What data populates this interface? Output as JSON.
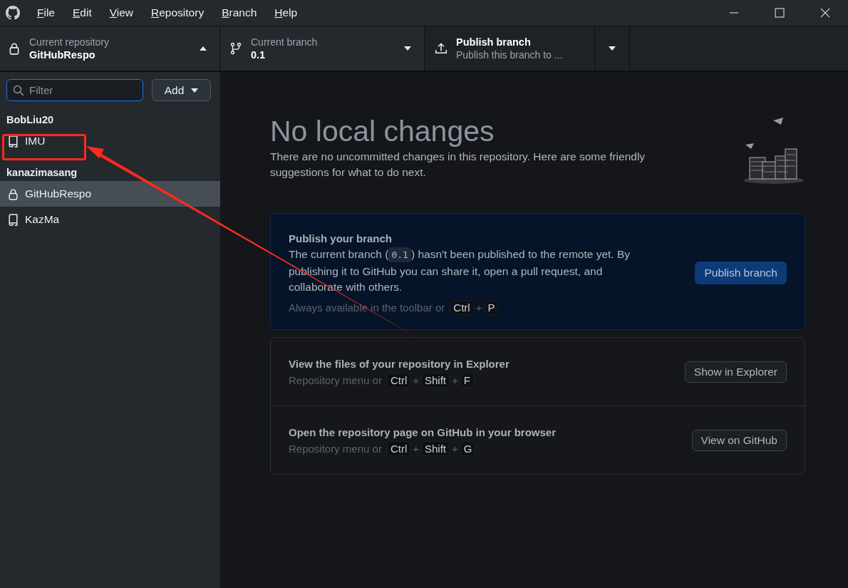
{
  "menu": [
    "File",
    "Edit",
    "View",
    "Repository",
    "Branch",
    "Help"
  ],
  "toolbar": {
    "repository": {
      "label": "Current repository",
      "value": "GitHubRespo",
      "expanded": true
    },
    "branch": {
      "label": "Current branch",
      "value": "0.1"
    },
    "publish": {
      "label": "Publish branch",
      "description": "Publish this branch to ..."
    }
  },
  "sidebar": {
    "filter": {
      "placeholder": "Filter"
    },
    "add_button": "Add",
    "groups": [
      {
        "owner": "BobLiu20",
        "repos": [
          {
            "name": "IMU",
            "kind": "public",
            "selected": false
          }
        ]
      },
      {
        "owner": "kanazimasang",
        "repos": [
          {
            "name": "GitHubRespo",
            "kind": "private",
            "selected": true
          },
          {
            "name": "KazMa",
            "kind": "public",
            "selected": false
          }
        ]
      }
    ]
  },
  "main": {
    "title": "No local changes",
    "subtitle": "There are no uncommitted changes in this repository. Here are some friendly suggestions for what to do next.",
    "publish_card": {
      "title": "Publish your branch",
      "text_before": "The current branch (",
      "code": "0.1",
      "text_after": ") hasn't been published to the remote yet. By publishing it to GitHub you can share it, open a pull request, and collaborate with others.",
      "hint": "Always available in the toolbar or",
      "shortcut": [
        {
          "kind": "key",
          "text": "Ctrl"
        },
        {
          "kind": "sep",
          "text": "+"
        },
        {
          "kind": "key",
          "text": "P"
        }
      ],
      "button": "Publish branch"
    },
    "actions": [
      {
        "title": "View the files of your repository in Explorer",
        "hint": "Repository menu or",
        "shortcut": [
          {
            "kind": "key",
            "text": "Ctrl"
          },
          {
            "kind": "sep",
            "text": "+"
          },
          {
            "kind": "key",
            "text": "Shift"
          },
          {
            "kind": "sep",
            "text": "+"
          },
          {
            "kind": "key",
            "text": "F"
          }
        ],
        "button": "Show in Explorer"
      },
      {
        "title": "Open the repository page on GitHub in your browser",
        "hint": "Repository menu or",
        "shortcut": [
          {
            "kind": "key",
            "text": "Ctrl"
          },
          {
            "kind": "sep",
            "text": "+"
          },
          {
            "kind": "key",
            "text": "Shift"
          },
          {
            "kind": "sep",
            "text": "+"
          },
          {
            "kind": "key",
            "text": "G"
          }
        ],
        "button": "View on GitHub"
      }
    ]
  }
}
